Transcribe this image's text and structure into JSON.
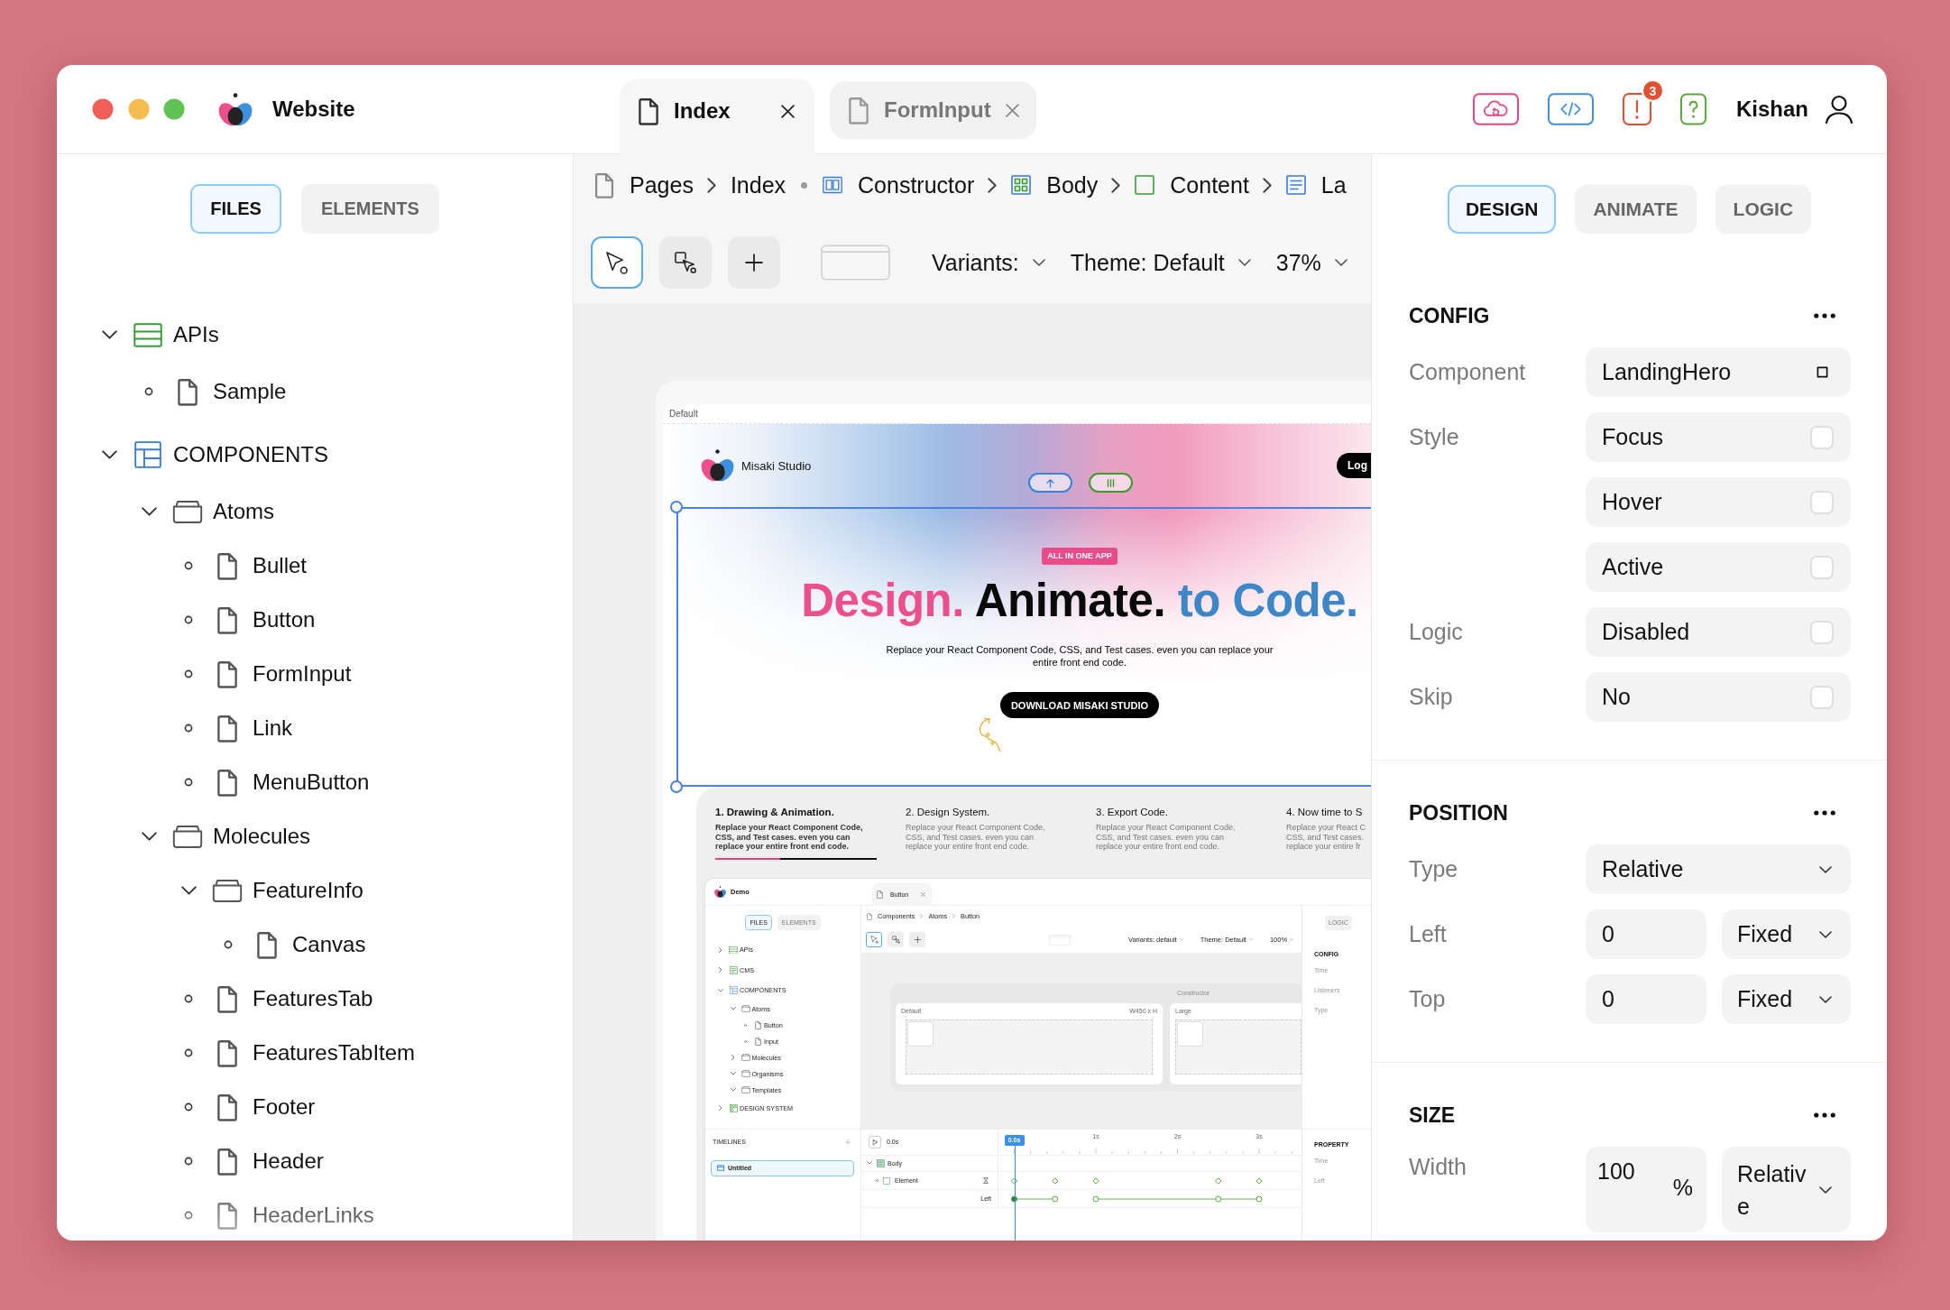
{
  "window": {
    "title": "Website"
  },
  "tabs": [
    {
      "label": "Index",
      "selected": true
    },
    {
      "label": "FormInput",
      "selected": false
    }
  ],
  "actions": [
    {
      "kind": "cloud",
      "color": "#e8457c"
    },
    {
      "kind": "code",
      "color": "#3b8fe0"
    },
    {
      "kind": "alert",
      "color": "#e2512f",
      "badge": "3"
    },
    {
      "kind": "help",
      "color": "#5aa83c"
    }
  ],
  "user": {
    "name": "Kishan"
  },
  "sidebar": {
    "tabs": [
      {
        "label": "FILES",
        "selected": true
      },
      {
        "label": "ELEMENTS",
        "selected": false
      }
    ],
    "tree": [
      {
        "label": "APIs",
        "kind": "api",
        "expanded": true,
        "children": [
          {
            "label": "Sample",
            "kind": "file"
          }
        ]
      },
      {
        "label": "COMPONENTS",
        "kind": "components",
        "expanded": true,
        "children": [
          {
            "label": "Atoms",
            "kind": "folder",
            "expanded": true,
            "children": [
              {
                "label": "Bullet",
                "kind": "file"
              },
              {
                "label": "Button",
                "kind": "file"
              },
              {
                "label": "FormInput",
                "kind": "file"
              },
              {
                "label": "Link",
                "kind": "file"
              },
              {
                "label": "MenuButton",
                "kind": "file"
              }
            ]
          },
          {
            "label": "Molecules",
            "kind": "folder",
            "expanded": true,
            "children": [
              {
                "label": "FeatureInfo",
                "kind": "folder",
                "expanded": true,
                "children": [
                  {
                    "label": "Canvas",
                    "kind": "file"
                  }
                ]
              },
              {
                "label": "FeaturesTab",
                "kind": "file"
              },
              {
                "label": "FeaturesTabItem",
                "kind": "file"
              },
              {
                "label": "Footer",
                "kind": "file"
              },
              {
                "label": "Header",
                "kind": "file"
              },
              {
                "label": "HeaderLinks",
                "kind": "file"
              }
            ]
          }
        ]
      }
    ]
  },
  "breadcrumb": [
    {
      "label": "Pages",
      "kind": "root"
    },
    {
      "label": "Index",
      "kind": "page"
    },
    {
      "label": "Constructor",
      "kind": "constructor"
    },
    {
      "label": "Body",
      "kind": "body"
    },
    {
      "label": "Content",
      "kind": "content"
    },
    {
      "label": "La",
      "kind": "layout"
    }
  ],
  "canvas_toolbar": {
    "tools": [
      {
        "kind": "pointer",
        "selected": true
      },
      {
        "kind": "marquee",
        "selected": false
      },
      {
        "kind": "add",
        "selected": false
      }
    ],
    "dropdowns": [
      {
        "label": "Variants:"
      },
      {
        "label": "Theme: Default"
      },
      {
        "label": "37%"
      }
    ]
  },
  "artboard": {
    "label": "Default",
    "hero": {
      "brand": "Misaki Studio",
      "pills": [
        {
          "kind": "arrow-up",
          "color": "#3b82d6"
        },
        {
          "kind": "bars",
          "color": "#3f9a2b"
        }
      ],
      "login": "Log",
      "selected": true,
      "badge": "ALL IN ONE APP",
      "headline": [
        {
          "text": "Design.",
          "color": "#ec4f8c"
        },
        {
          "text": "Animate.",
          "color": "#0a0a0a"
        },
        {
          "text": "to Code.",
          "color": "#3d87c9"
        }
      ],
      "subtitle": [
        "Replace your React Component Code, CSS, and Test cases. even you can replace your",
        "entire front end code."
      ],
      "cta": "DOWNLOAD MISAKI STUDIO"
    },
    "features": [
      {
        "title": "1. Drawing & Animation.",
        "lines": [
          "Replace your React Component Code,",
          "CSS, and Test cases. even you can",
          "replace your entire front end code."
        ],
        "selected": true,
        "progress": {
          "level": 0.4
        }
      },
      {
        "title": "2. Design System.",
        "lines": [
          "Replace your React Component Code,",
          "CSS, and Test cases. even you can",
          "replace your entire front end code."
        ],
        "selected": false
      },
      {
        "title": "3. Export Code.",
        "lines": [
          "Replace your React Component Code,",
          "CSS, and Test cases. even you can",
          "replace your entire front end code."
        ],
        "selected": false
      },
      {
        "title": "4. Now time to S",
        "lines": [
          "Replace your React C",
          "CSS, and Test cases.",
          "replace your entire fr"
        ],
        "selected": false
      }
    ],
    "demo": {
      "title": "Demo",
      "tabs": [
        {
          "label": "Button",
          "selected": true
        }
      ],
      "sidebar_tabs": [
        {
          "label": "FILES",
          "selected": true
        },
        {
          "label": "ELEMENTS",
          "selected": false
        }
      ],
      "tree": [
        {
          "label": "APIs",
          "kind": "api",
          "expanded": false
        },
        {
          "label": "CMS",
          "kind": "cms",
          "expanded": false
        },
        {
          "label": "COMPONENTS",
          "kind": "components",
          "expanded": true,
          "children": [
            {
              "label": "Atoms",
              "kind": "folder",
              "expanded": true,
              "children": [
                {
                  "label": "Button",
                  "kind": "file"
                },
                {
                  "label": "Input",
                  "kind": "file"
                }
              ]
            },
            {
              "label": "Molecules",
              "kind": "folder",
              "expanded": false
            },
            {
              "label": "Organisms",
              "kind": "folder",
              "expanded": true
            },
            {
              "label": "Templates",
              "kind": "folder",
              "expanded": true
            }
          ]
        },
        {
          "label": "DESIGN SYSTEM",
          "kind": "design",
          "expanded": false
        }
      ],
      "breadcrumb": [
        {
          "label": "Components",
          "kind": "root"
        },
        {
          "label": "Atoms",
          "kind": "folder"
        },
        {
          "label": "Button",
          "kind": "file"
        }
      ],
      "tools": [
        {
          "kind": "pointer",
          "selected": true
        },
        {
          "kind": "marquee",
          "selected": false
        },
        {
          "kind": "add",
          "selected": false
        }
      ],
      "dropdowns": [
        {
          "label": "Variants: default"
        },
        {
          "label": "Theme: Default"
        },
        {
          "label": "100%"
        }
      ],
      "constructor_frame": {
        "title": "Constructor",
        "variants": [
          {
            "label": "Default",
            "size": "W450 x H"
          },
          {
            "label": "Large"
          }
        ]
      },
      "panel": {
        "tabs": [
          {
            "label": "LOGIC",
            "selected": false
          }
        ],
        "section": "CONFIG",
        "fields": [
          {
            "label": "Time"
          },
          {
            "label": "Listeners"
          },
          {
            "label": "Type"
          }
        ]
      },
      "timelines": {
        "title": "TIMELINES",
        "items": [
          {
            "label": "Untitled",
            "selected": true
          }
        ]
      },
      "player": {
        "time": "0.0s",
        "playhead": "0.0s",
        "ticks": [
          "1s",
          "2s",
          "3s"
        ]
      },
      "tracks": [
        {
          "label": "Body",
          "kind": "group",
          "expanded": true,
          "children": [
            {
              "label": "Element",
              "kind": "element",
              "keyframes": [
                {
                  "selected": false
                },
                {
                  "selected": false
                },
                {
                  "selected": false
                },
                {
                  "selected": false
                },
                {
                  "selected": false
                }
              ],
              "children": [
                {
                  "label": "Left",
                  "kind": "property",
                  "keyframes": [
                    {
                      "selected": true
                    },
                    {
                      "selected": false
                    },
                    {
                      "selected": false
                    },
                    {
                      "selected": false
                    },
                    {
                      "selected": false
                    }
                  ]
                }
              ]
            }
          ]
        }
      ],
      "properties": {
        "title": "PROPERTY",
        "fields": [
          {
            "label": "Time"
          },
          {
            "label": "Left"
          }
        ]
      }
    }
  },
  "inspector": {
    "tabs": [
      {
        "label": "DESIGN",
        "selected": true
      },
      {
        "label": "ANIMATE",
        "selected": false
      },
      {
        "label": "LOGIC",
        "selected": false
      }
    ],
    "sections": [
      {
        "title": "CONFIG",
        "rows": [
          {
            "label": "Component",
            "kind": "value",
            "value": "LandingHero"
          },
          {
            "label": "Style",
            "kind": "toggle",
            "value": "Focus",
            "checked": false
          },
          {
            "kind": "toggle",
            "value": "Hover",
            "checked": false
          },
          {
            "kind": "toggle",
            "value": "Active",
            "checked": false
          },
          {
            "label": "Logic",
            "kind": "toggle",
            "value": "Disabled",
            "checked": false
          },
          {
            "label": "Skip",
            "kind": "toggle",
            "value": "No",
            "checked": false
          }
        ]
      },
      {
        "title": "POSITION",
        "rows": [
          {
            "label": "Type",
            "kind": "select",
            "value": "Relative"
          },
          {
            "label": "Left",
            "kind": "number-unit",
            "value": "0",
            "unit": "Fixed"
          },
          {
            "label": "Top",
            "kind": "number-unit",
            "value": "0",
            "unit": "Fixed"
          }
        ]
      },
      {
        "title": "SIZE",
        "rows": [
          {
            "label": "Width",
            "kind": "number-unit",
            "value": "100",
            "suffix": "%",
            "unit": "Relative"
          }
        ]
      }
    ]
  }
}
